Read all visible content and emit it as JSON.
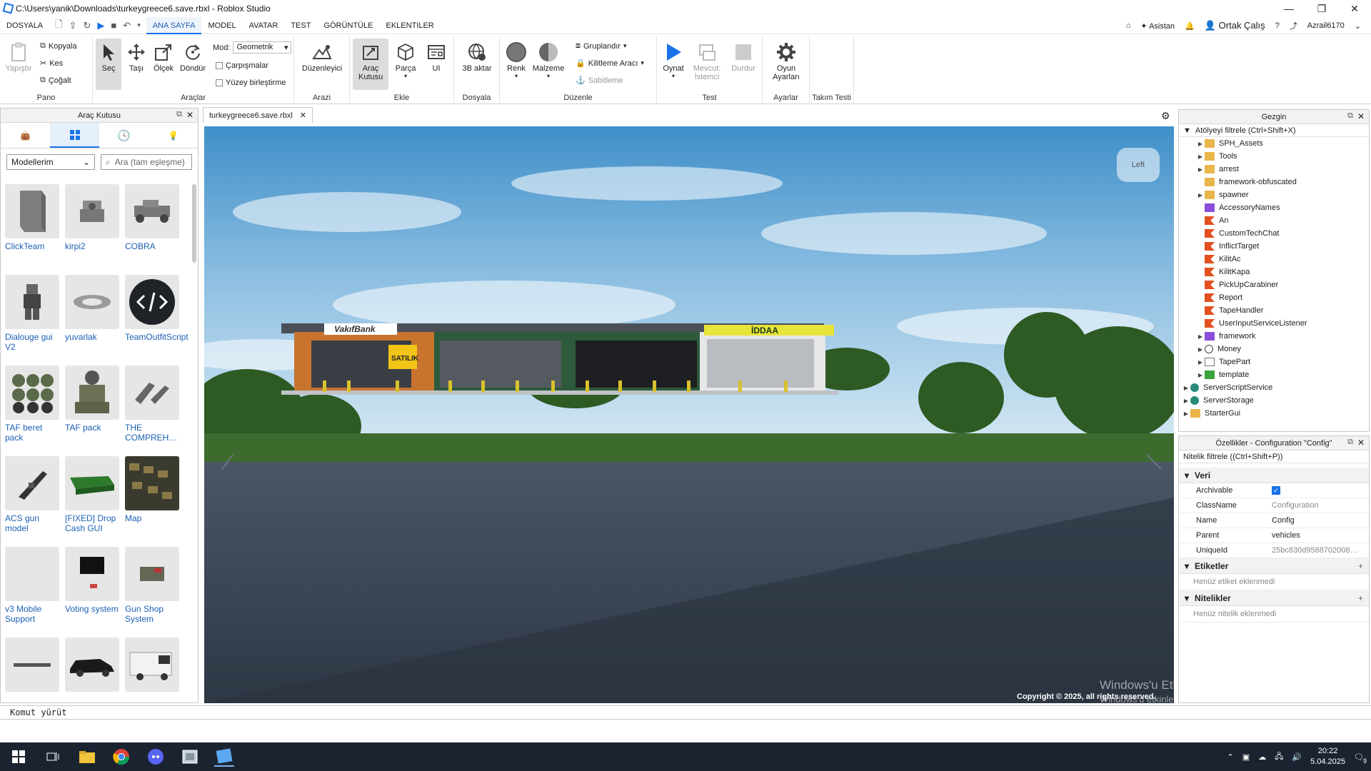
{
  "window": {
    "title": "C:\\Users\\yanik\\Downloads\\turkeygreece6.save.rbxl - Roblox Studio",
    "minimize": "—",
    "maximize": "❐",
    "close": "✕"
  },
  "menu": {
    "items": [
      "DOSYALA",
      "ANA SAYFA",
      "MODEL",
      "AVATAR",
      "TEST",
      "GÖRÜNTÜLE",
      "EKLENTILER"
    ],
    "active": "ANA SAYFA",
    "assistant": "Asistan",
    "collab": "Ortak Çalış",
    "user": "Azrail6170"
  },
  "ribbon": {
    "pano": {
      "label": "Pano",
      "paste": "Yapıştır",
      "copy": "Kopyala",
      "cut": "Kes",
      "duplicate": "Çoğalt"
    },
    "araclar": {
      "label": "Araçlar",
      "select": "Seç",
      "move": "Taşı",
      "scale": "Ölçek",
      "rotate": "Döndür",
      "mode_label": "Mod:",
      "mode_value": "Geometrik",
      "collisions": "Çarpışmalar",
      "surface_join": "Yüzey birleştirme"
    },
    "arazi": {
      "label": "Arazi",
      "editor": "Düzenleyici"
    },
    "ekle": {
      "label": "Ekle",
      "toolbox": "Araç Kutusu",
      "part": "Parça",
      "ui": "UI"
    },
    "dosya": {
      "label": "Dosyala",
      "import3d": "3B aktar"
    },
    "duzenle": {
      "label": "Düzenle",
      "color": "Renk",
      "material": "Malzeme",
      "group": "Gruplandır",
      "lock": "Kilitleme Aracı",
      "anchor": "Sabitleme"
    },
    "test": {
      "label": "Test",
      "play": "Oynat",
      "current_client": "Mevcut: İstemci",
      "stop": "Durdur"
    },
    "ayarlar": {
      "label": "Ayarlar",
      "game_settings": "Oyun Ayarları"
    },
    "takim": {
      "label": "Takım Testi"
    }
  },
  "toolbox": {
    "title": "Araç Kutusu",
    "category": "Modellerim",
    "search_placeholder": "Ara (tam eşleşme)",
    "items": [
      {
        "name": "ClickTeam",
        "icon": "gray-block"
      },
      {
        "name": "kirpi2",
        "icon": "robot"
      },
      {
        "name": "COBRA",
        "icon": "armored-car"
      },
      {
        "name": "Dialouge gui V2",
        "icon": "avatar"
      },
      {
        "name": "yuvarlak",
        "icon": "ring"
      },
      {
        "name": "TeamOutfitScript",
        "icon": "code-circle"
      },
      {
        "name": "TAF beret pack",
        "icon": "berets"
      },
      {
        "name": "TAF pack",
        "icon": "soldier-pack"
      },
      {
        "name": "THE COMPREH…",
        "icon": "parts"
      },
      {
        "name": "ACS gun model",
        "icon": "gun"
      },
      {
        "name": "[FIXED] Drop Cash GUI",
        "icon": "green-slab"
      },
      {
        "name": "Map",
        "icon": "map"
      },
      {
        "name": "v3 Mobile Support",
        "icon": "blank"
      },
      {
        "name": "Voting system",
        "icon": "screen"
      },
      {
        "name": "Gun Shop System",
        "icon": "shop"
      },
      {
        "name": "",
        "icon": "rifle"
      },
      {
        "name": "",
        "icon": "car"
      },
      {
        "name": "",
        "icon": "van"
      }
    ]
  },
  "document_tab": {
    "label": "turkeygreece6.save.rbxl"
  },
  "viewport": {
    "view_cube": "Left",
    "signs": {
      "bank": "VakıfBank",
      "sale": "SATILIK",
      "betting": "İDDAA"
    },
    "copyright": "Copyright © 2025, all rights reserved.",
    "activation_title": "Windows'u Etkinleştir",
    "activation_sub": "Windows'u etkinleştirmek için Ayarlar'a gidin."
  },
  "explorer": {
    "title": "Gezgin",
    "filter": "Atölyeyi filtrele (Ctrl+Shift+X)",
    "nodes": [
      {
        "label": "SPH_Assets",
        "icon": "folder",
        "depth": 2,
        "arrow": "▶"
      },
      {
        "label": "Tools",
        "icon": "folder",
        "depth": 2,
        "arrow": "▶"
      },
      {
        "label": "arrest",
        "icon": "folder",
        "depth": 2,
        "arrow": "▶"
      },
      {
        "label": "framework-obfuscated",
        "icon": "folder",
        "depth": 2,
        "arrow": ""
      },
      {
        "label": "spawner",
        "icon": "folder",
        "depth": 2,
        "arrow": "▶"
      },
      {
        "label": "AccessoryNames",
        "icon": "module",
        "depth": 2,
        "arrow": ""
      },
      {
        "label": "An",
        "icon": "script",
        "depth": 2,
        "arrow": ""
      },
      {
        "label": "CustomTechChat",
        "icon": "script",
        "depth": 2,
        "arrow": ""
      },
      {
        "label": "InflictTarget",
        "icon": "script",
        "depth": 2,
        "arrow": ""
      },
      {
        "label": "KilitAc",
        "icon": "script",
        "depth": 2,
        "arrow": ""
      },
      {
        "label": "KilitKapa",
        "icon": "script",
        "depth": 2,
        "arrow": ""
      },
      {
        "label": "PickUpCarabiner",
        "icon": "script",
        "depth": 2,
        "arrow": ""
      },
      {
        "label": "Report",
        "icon": "script",
        "depth": 2,
        "arrow": ""
      },
      {
        "label": "TapeHandler",
        "icon": "script",
        "depth": 2,
        "arrow": ""
      },
      {
        "label": "UserInputServiceListener",
        "icon": "script",
        "depth": 2,
        "arrow": ""
      },
      {
        "label": "framework",
        "icon": "module",
        "depth": 2,
        "arrow": "▶"
      },
      {
        "label": "Money",
        "icon": "globe",
        "depth": 2,
        "arrow": "▶"
      },
      {
        "label": "TapePart",
        "icon": "part",
        "depth": 2,
        "arrow": "▶"
      },
      {
        "label": "template",
        "icon": "bool",
        "depth": 2,
        "arrow": "▶"
      },
      {
        "label": "ServerScriptService",
        "icon": "service",
        "depth": 1,
        "arrow": "▶"
      },
      {
        "label": "ServerStorage",
        "icon": "service",
        "depth": 1,
        "arrow": "▶"
      },
      {
        "label": "StarterGui",
        "icon": "folder",
        "depth": 1,
        "arrow": "▶"
      }
    ]
  },
  "properties": {
    "title": "Özellikler - Configuration \"Config\"",
    "filter": "Nitelik filtrele ((Ctrl+Shift+P))",
    "section_data": "Veri",
    "rows": [
      {
        "key": "Archivable",
        "value": "✓"
      },
      {
        "key": "ClassName",
        "value": "Configuration"
      },
      {
        "key": "Name",
        "value": "Config"
      },
      {
        "key": "Parent",
        "value": "vehicles"
      },
      {
        "key": "UniqueId",
        "value": "25bc830d9588702008…"
      }
    ],
    "section_tags": "Etiketler",
    "tags_empty": "Henüz etiket eklenmedi",
    "section_attrs": "Nitelikler",
    "attrs_empty": "Henüz nitelik eklenmedi"
  },
  "command_bar": {
    "placeholder": "Komut yürüt"
  },
  "taskbar": {
    "time": "20:22",
    "date": "5.04.2025",
    "notifications": "9"
  }
}
